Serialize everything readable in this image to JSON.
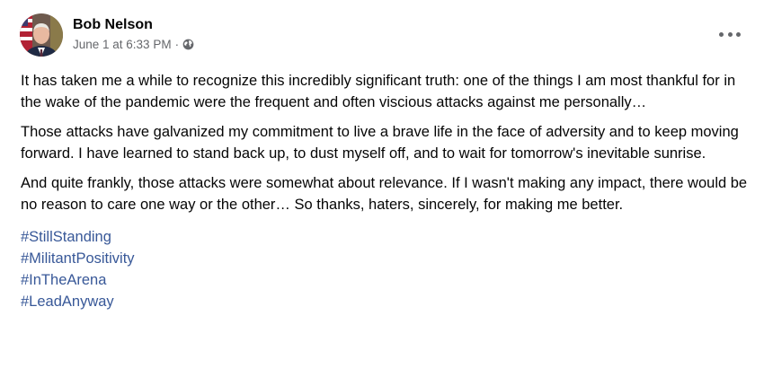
{
  "post": {
    "author": "Bob Nelson",
    "timestamp": "June 1 at 6:33 PM",
    "separator": "·",
    "privacy_icon": "globe-icon",
    "more_icon": "more-options-icon",
    "paragraphs": [
      "It has taken me a while to recognize this incredibly significant truth: one of the things I am most thankful for in the wake of the pandemic were the frequent and often viscious attacks against me personally…",
      "Those attacks have galvanized my commitment to live a brave life in the face of adversity and to keep moving forward. I have learned to stand back up, to dust myself off, and to wait for tomorrow's inevitable sunrise.",
      "And quite frankly, those attacks were somewhat about relevance.  If I wasn't making any impact, there would be no reason to care one way or the other… So thanks, haters, sincerely, for making me better."
    ],
    "hashtags": [
      "#StillStanding",
      "#MilitantPositivity",
      "#InTheArena",
      "#LeadAnyway"
    ]
  },
  "colors": {
    "text": "#050505",
    "secondary": "#65676b",
    "hashtag": "#385898"
  }
}
